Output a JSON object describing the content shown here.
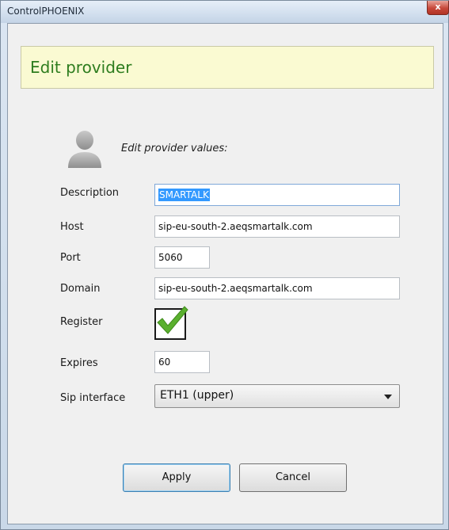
{
  "window": {
    "title": "ControlPHOENIX",
    "close_glyph": "x"
  },
  "banner": {
    "title": "Edit provider",
    "background_color": "#fafad2",
    "title_color": "#2e7d1f"
  },
  "header": {
    "icon": "user-avatar-icon",
    "subtitle": "Edit provider values:"
  },
  "form": {
    "description": {
      "label": "Description",
      "value": "SMARTALK"
    },
    "host": {
      "label": "Host",
      "value": "sip-eu-south-2.aeqsmartalk.com"
    },
    "port": {
      "label": "Port",
      "value": "5060"
    },
    "domain": {
      "label": "Domain",
      "value": "sip-eu-south-2.aeqsmartalk.com"
    },
    "register": {
      "label": "Register",
      "checked": true,
      "check_color": "#5ab02e"
    },
    "expires": {
      "label": "Expires",
      "value": "60"
    },
    "sip_interface": {
      "label": "Sip interface",
      "selected": "ETH1 (upper)"
    }
  },
  "buttons": {
    "apply": "Apply",
    "cancel": "Cancel"
  }
}
